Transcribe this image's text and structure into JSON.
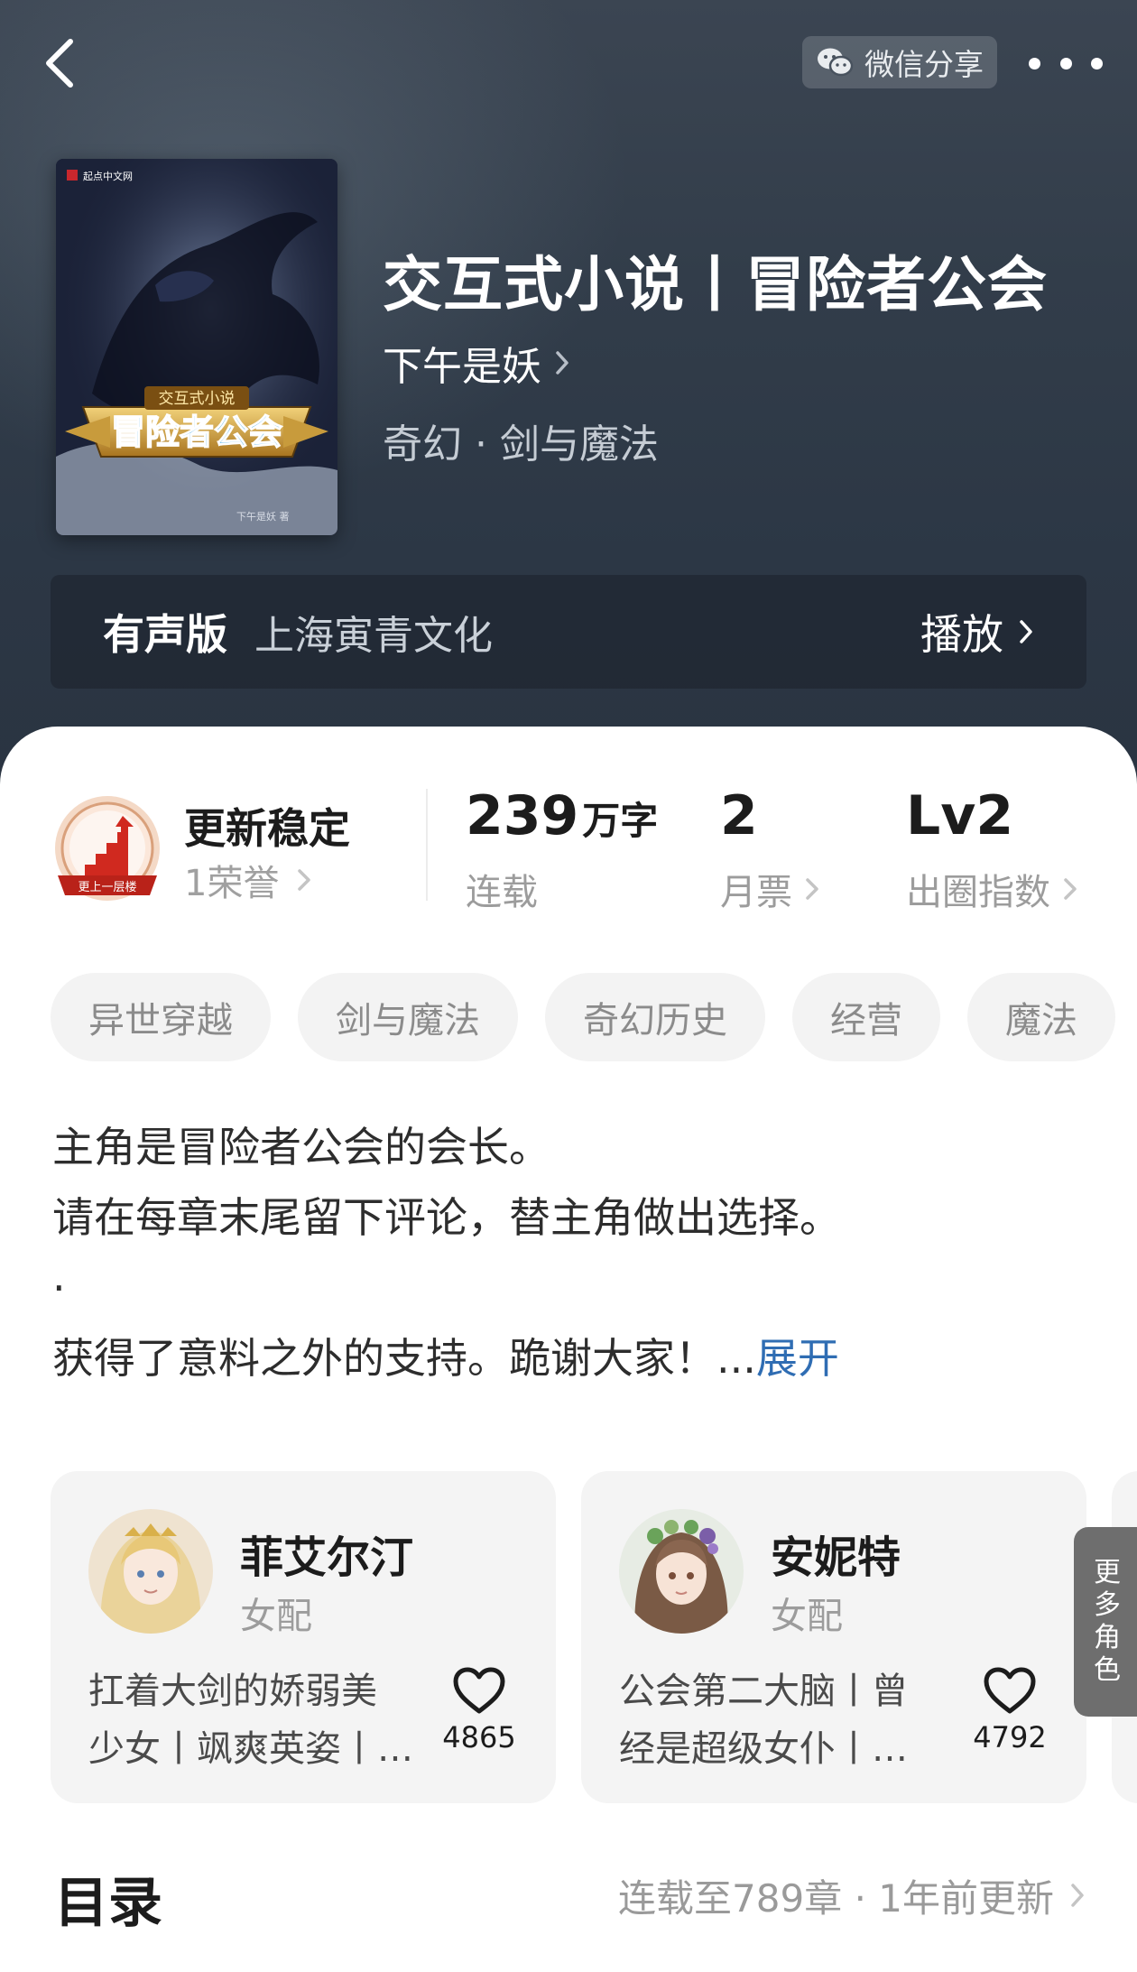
{
  "header": {
    "share_label": "微信分享",
    "icons": [
      "back-arrow-icon",
      "wechat-icon",
      "more-dots-icon"
    ]
  },
  "book": {
    "title": "交互式小说丨冒险者公会",
    "author": "下午是妖",
    "genre": "奇幻 · 剑与魔法",
    "cover_text": "冒险者公会",
    "cover_subtitle": "交互式小说",
    "cover_publisher": "起点中文网",
    "cover_author": "下午是妖 著"
  },
  "audio": {
    "label": "有声版",
    "publisher": "上海寅青文化",
    "play_label": "播放"
  },
  "honor": {
    "badge_text": "更上一层楼",
    "title": "更新稳定",
    "subtitle": "1荣誉"
  },
  "stats": [
    {
      "value": "239",
      "unit": "万字",
      "label": "连载"
    },
    {
      "value": "2",
      "unit": "",
      "label": "月票"
    },
    {
      "value": "Lv2",
      "unit": "",
      "label": "出圈指数"
    }
  ],
  "tags": [
    "异世穿越",
    "剑与魔法",
    "奇幻历史",
    "经营",
    "魔法"
  ],
  "synopsis": {
    "lines": [
      "主角是冒险者公会的会长。",
      "请在每章末尾留下评论，替主角做出选择。",
      "·",
      "获得了意料之外的支持。跪谢大家！..."
    ],
    "expand_label": "展开"
  },
  "characters": [
    {
      "name": "菲艾尔汀",
      "role": "女配",
      "desc_line1": "扛着大剑的娇弱美",
      "desc_line2": "少女丨飒爽英姿丨…",
      "likes": "4865"
    },
    {
      "name": "安妮特",
      "role": "女配",
      "desc_line1": "公会第二大脑丨曾",
      "desc_line2": "经是超级女仆丨…",
      "likes": "4792"
    }
  ],
  "more_roles_chars": [
    "更",
    "多",
    "角",
    "色"
  ],
  "catalog": {
    "title": "目录",
    "info": "连载至789章 · 1年前更新"
  },
  "colors": {
    "header_bg": "#323d4a",
    "expand_link": "#2f6db3",
    "tag_bg": "#f3f3f3",
    "card_bg": "#f4f4f4"
  }
}
